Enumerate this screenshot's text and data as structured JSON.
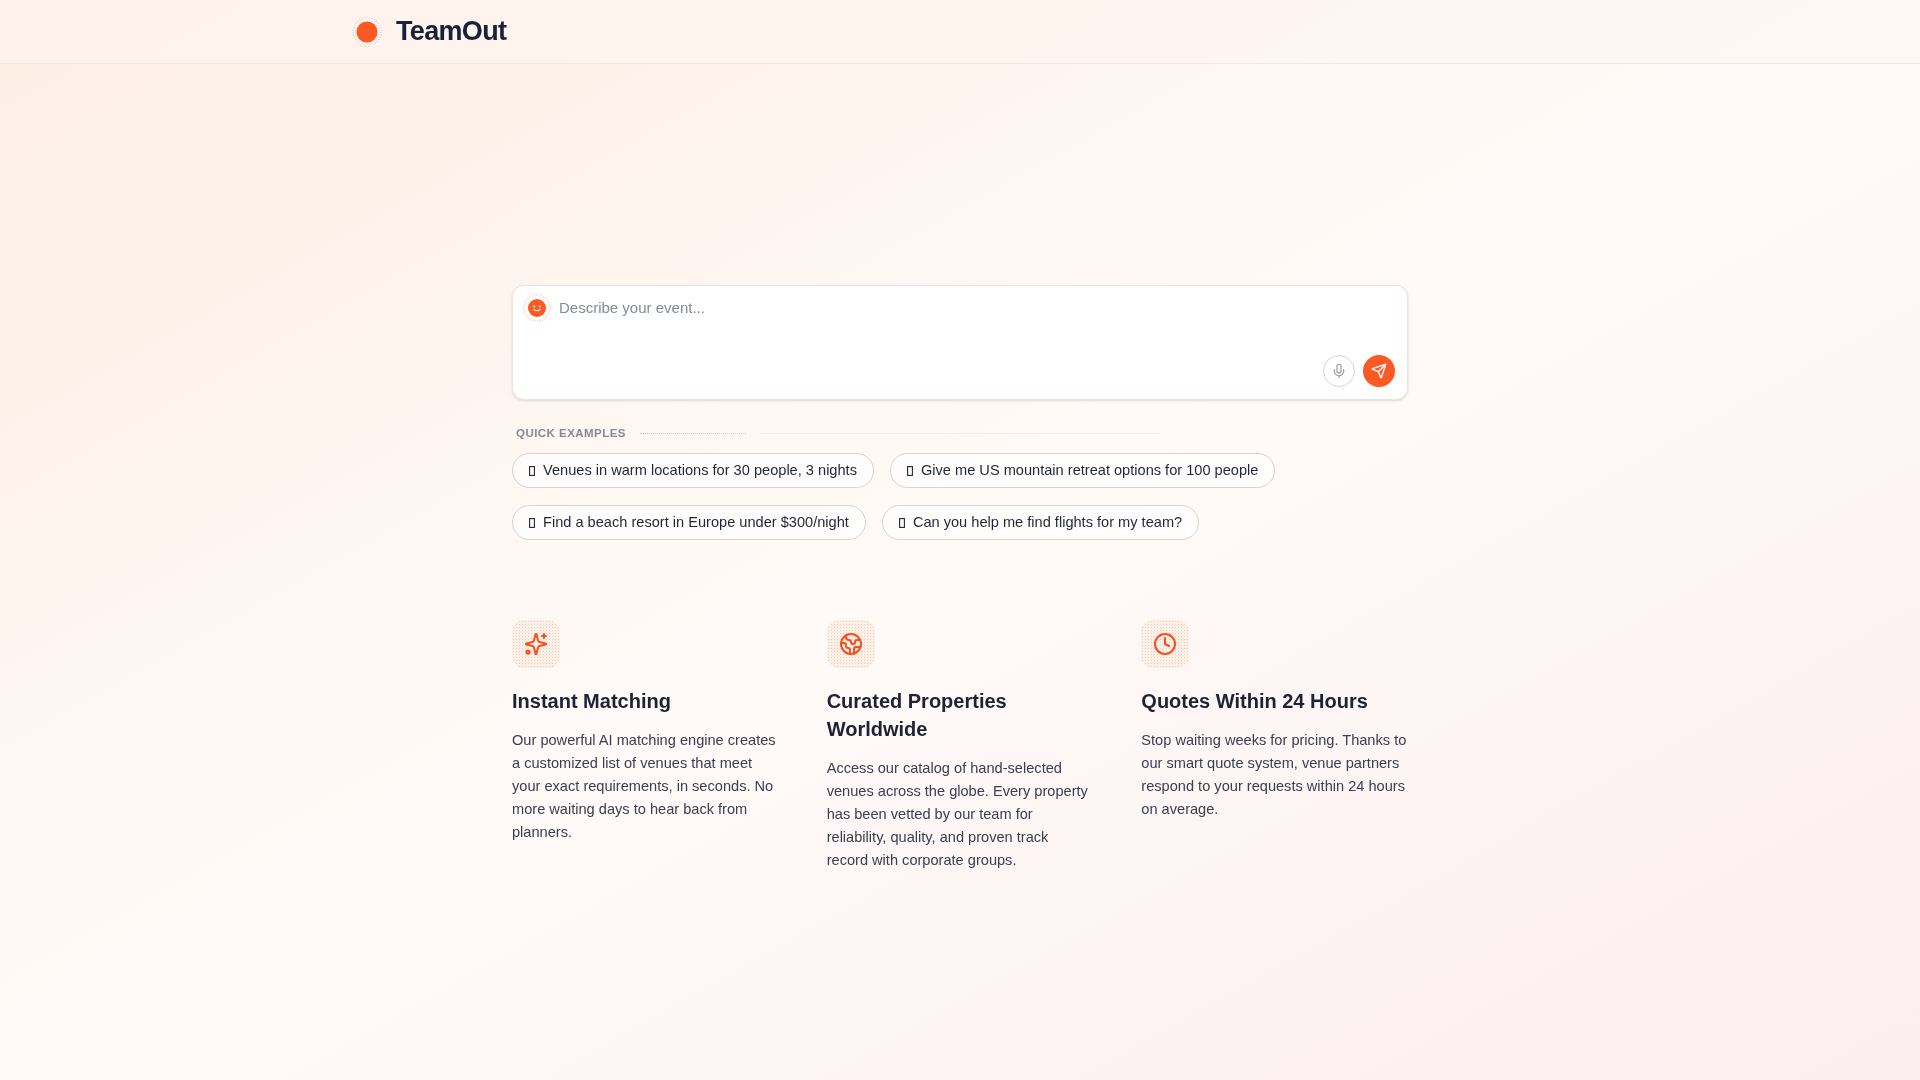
{
  "header": {
    "brand": "TeamOut"
  },
  "composer": {
    "placeholder": "Describe your event..."
  },
  "quick_examples": {
    "heading": "QUICK EXAMPLES",
    "items": [
      "Venues in warm locations for 30 people, 3 nights",
      "Give me US mountain retreat options for 100 people",
      "Find a beach resort in Europe under $300/night",
      "Can you help me find flights for my team?"
    ]
  },
  "features": [
    {
      "title": "Instant Matching",
      "description": "Our powerful AI matching engine creates a customized list of venues that meet your exact requirements, in seconds. No more waiting days to hear back from planners."
    },
    {
      "title": "Curated Properties Worldwide",
      "description": "Access our catalog of hand-selected venues across the globe. Every property has been vetted by our team for reliability, quality, and proven track record with corporate groups."
    },
    {
      "title": "Quotes Within 24 Hours",
      "description": "Stop waiting weeks for pricing. Thanks to our smart quote system, venue partners respond to your requests within 24 hours on average."
    }
  ]
}
